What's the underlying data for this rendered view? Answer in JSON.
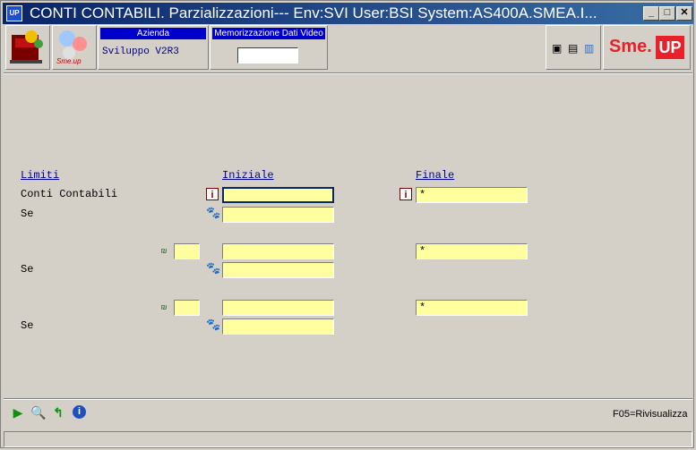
{
  "window": {
    "title": "CONTI CONTABILI.  Parzializzazioni--- Env:SVI User:BSI System:AS400A.SMEA.I...",
    "app_icon_text": "UP",
    "min_symbol": "_",
    "max_symbol": "□",
    "close_symbol": "✕"
  },
  "toolbar": {
    "azienda_label": "Azienda",
    "azienda_value": "Sviluppo V2R3",
    "memorizzazione_label": "Memorizzazione Dati Video",
    "memorizzazione_value": "",
    "logo_text_left": "Sme.",
    "logo_text_right": "UP",
    "logo_small": "Sme.up"
  },
  "form": {
    "header_limiti": "Limiti",
    "header_iniziale": "Iniziale",
    "header_finale": "Finale",
    "row1_label": "Conti Contabili",
    "row1_iniziale": "",
    "row1_finale": "*",
    "se_label": "Se",
    "row1_se": "",
    "group2_code": "",
    "group2_iniziale": "",
    "group2_finale": "*",
    "group2_se": "",
    "group3_code": "",
    "group3_iniziale": "",
    "group3_finale": "*",
    "group3_se": ""
  },
  "footer": {
    "f05": "F05=Rivisualizza"
  },
  "colors": {
    "title_bar": "#0a246a",
    "field_bg": "#ffffa0",
    "header_blue": "#0000cc",
    "logo_red": "#e8202a"
  }
}
